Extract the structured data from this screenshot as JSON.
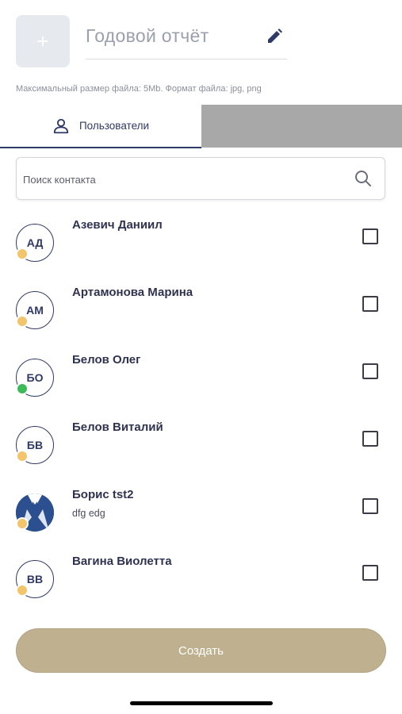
{
  "header": {
    "upload_icon": "plus-icon",
    "upload_symbol": "+",
    "title": "Годовой отчёт",
    "edit_icon": "pencil-icon",
    "file_hint": "Максимальный размер файла: 5Mb. Формат файла: jpg, png"
  },
  "tabs": {
    "users_label": "Пользователи",
    "users_icon": "user-icon"
  },
  "search": {
    "placeholder": "Поиск контакта",
    "value": "",
    "icon": "search-icon"
  },
  "contacts": [
    {
      "initials": "АД",
      "name": "Азевич Даниил",
      "sub": "",
      "status": "away",
      "status_color": "#f2c46b",
      "checked": false
    },
    {
      "initials": "АМ",
      "name": "Артамонова Марина",
      "sub": "",
      "status": "away",
      "status_color": "#f2c46b",
      "checked": false
    },
    {
      "initials": "БО",
      "name": "Белов Олег",
      "sub": "",
      "status": "online",
      "status_color": "#3dbb5a",
      "checked": false
    },
    {
      "initials": "БВ",
      "name": "Белов Виталий",
      "sub": "",
      "status": "away",
      "status_color": "#f2c46b",
      "checked": false
    },
    {
      "initials": "",
      "name": "Борис tst2",
      "sub": "dfg edg",
      "status": "away",
      "status_color": "#f2c46b",
      "checked": false,
      "photo": true
    },
    {
      "initials": "ВВ",
      "name": "Вагина Виолетта",
      "sub": "",
      "status": "away",
      "status_color": "#f2c46b",
      "checked": false
    }
  ],
  "footer": {
    "create_label": "Создать"
  },
  "colors": {
    "accent": "#2f3a66",
    "button": "#bfb08f",
    "inactive_tab": "#a8a8a8"
  }
}
